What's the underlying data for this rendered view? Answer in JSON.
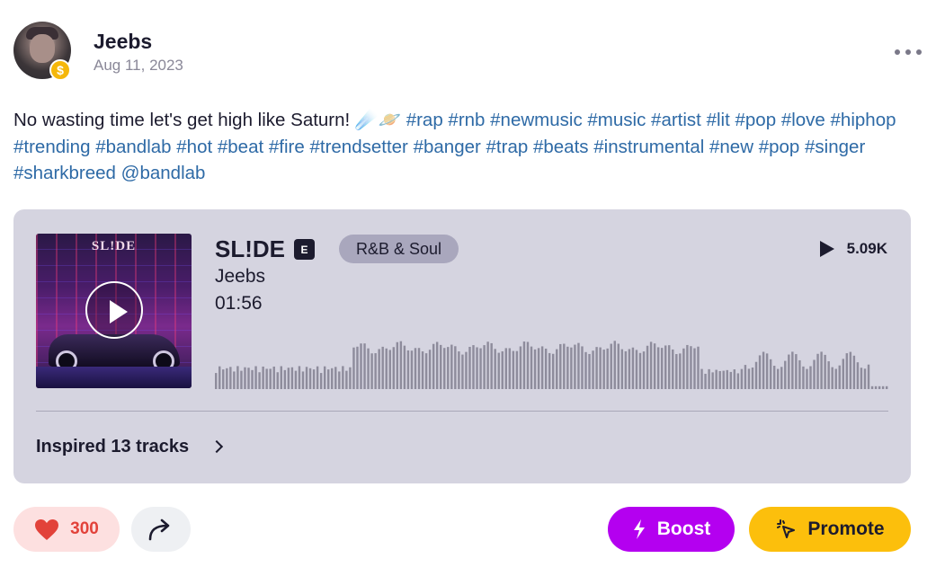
{
  "post": {
    "author": "Jeebs",
    "date": "Aug 11, 2023",
    "avatar_badge": "$",
    "more_icon": "more-horizontal-icon",
    "caption": {
      "text": "No wasting time let's get high like Saturn! ☄️🪐",
      "hashtags": [
        "#rap",
        "#rnb",
        "#newmusic",
        "#music",
        "#artist",
        "#lit",
        "#pop",
        "#love",
        "#hiphop",
        "#trending",
        "#bandlab",
        "#hot",
        "#beat",
        "#fire",
        "#trendsetter",
        "#banger",
        "#trap",
        "#beats",
        "#instrumental",
        "#new",
        "#pop",
        "#singer",
        "#sharkbreed",
        "@bandlab"
      ]
    }
  },
  "track": {
    "cover_text": "SL!DE",
    "title": "SL!DE",
    "explicit_badge": "E",
    "genre": "R&B & Soul",
    "plays": "5.09K",
    "artist": "Jeebs",
    "duration": "01:56",
    "waveform_color": "#8e8c9c",
    "inspired_label": "Inspired 13 tracks"
  },
  "actions": {
    "like_count": "300",
    "boost_label": "Boost",
    "promote_label": "Promote"
  },
  "colors": {
    "card_bg": "#d5d4e0",
    "hashtag": "#2e6aa6",
    "boost": "#b400f0",
    "promote": "#fcbf0c",
    "like_bg": "#fde0e0",
    "like_heart": "#e2423a"
  }
}
